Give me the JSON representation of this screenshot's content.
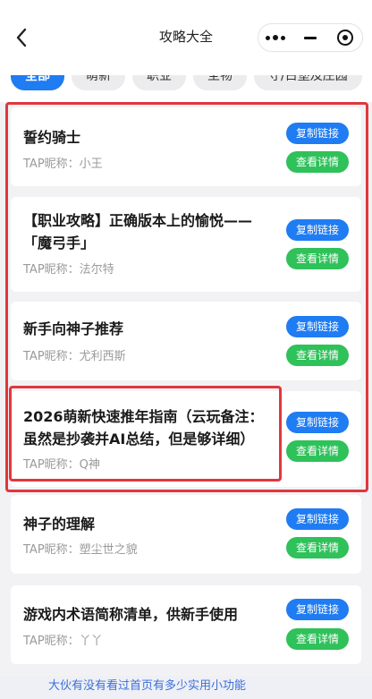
{
  "nav": {
    "title": "攻略大全"
  },
  "tabs": [
    {
      "label": "全部",
      "active": true
    },
    {
      "label": "萌新",
      "active": false
    },
    {
      "label": "职业",
      "active": false
    },
    {
      "label": "圣物",
      "active": false
    },
    {
      "label": "守/占堡及庄园",
      "active": false
    }
  ],
  "buttons": {
    "copy_label": "复制链接",
    "view_label": "查看详情"
  },
  "articles": [
    {
      "title": "誓约骑士",
      "author": "TAP昵称：小王"
    },
    {
      "title": "【职业攻略】正确版本上的愉悦——「魔弓手」",
      "author": "TAP昵称：法尔特"
    },
    {
      "title": "新手向神子推荐",
      "author": "TAP昵称：尤利西斯"
    },
    {
      "title": "2026萌新快速推年指南（云玩备注：虽然是抄袭并AI总结，但是够详细）",
      "author": "TAP昵称：Q神"
    },
    {
      "title": "神子的理解",
      "author": "TAP昵称：塑尘世之貌"
    },
    {
      "title": "游戏内术语简称清单，供新手使用",
      "author": "TAP昵称：丫丫"
    }
  ],
  "footer": {
    "text": "大伙有没有看过首页有多少实用小功能"
  }
}
